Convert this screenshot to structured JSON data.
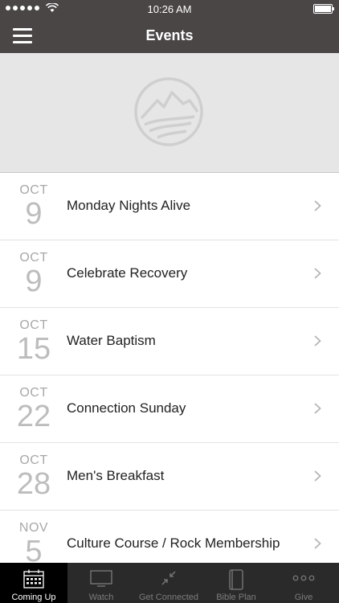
{
  "status": {
    "time": "10:26 AM"
  },
  "nav": {
    "title": "Events"
  },
  "events": [
    {
      "month": "OCT",
      "day": "9",
      "title": "Monday Nights Alive"
    },
    {
      "month": "OCT",
      "day": "9",
      "title": "Celebrate Recovery"
    },
    {
      "month": "OCT",
      "day": "15",
      "title": "Water Baptism"
    },
    {
      "month": "OCT",
      "day": "22",
      "title": "Connection Sunday"
    },
    {
      "month": "OCT",
      "day": "28",
      "title": "Men's Breakfast"
    },
    {
      "month": "NOV",
      "day": "5",
      "title": "Culture Course / Rock Membership"
    }
  ],
  "tabs": [
    {
      "label": "Coming Up",
      "icon": "calendar-icon",
      "active": true
    },
    {
      "label": "Watch",
      "icon": "tv-icon",
      "active": false
    },
    {
      "label": "Get Connected",
      "icon": "connect-arrows-icon",
      "active": false
    },
    {
      "label": "Bible Plan",
      "icon": "book-icon",
      "active": false
    },
    {
      "label": "Give",
      "icon": "more-dots-icon",
      "active": false
    }
  ]
}
